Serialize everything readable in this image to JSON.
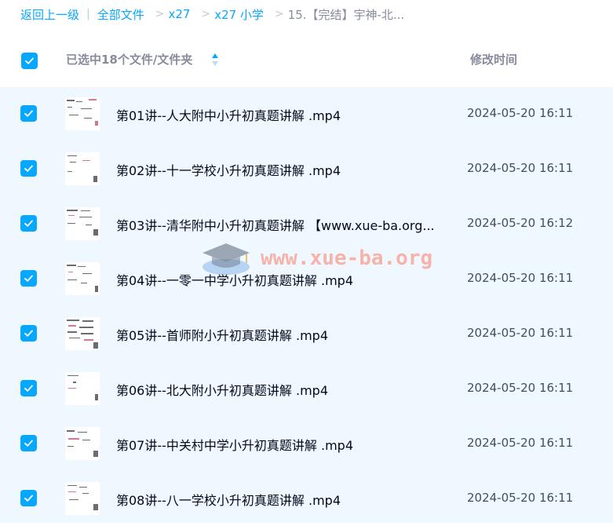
{
  "breadcrumb": {
    "back": "返回上一级",
    "sep": "|",
    "items": [
      "全部文件",
      "x27",
      "x27 小学"
    ],
    "current": "15.【完结】宇神-北..."
  },
  "header": {
    "selected_text": "已选中18个文件/文件夹",
    "time_col": "修改时间"
  },
  "files": [
    {
      "name": "第01讲--人大附中小升初真题讲解 .mp4",
      "time": "2024-05-20 16:11"
    },
    {
      "name": "第02讲--十一学校小升初真题讲解 .mp4",
      "time": "2024-05-20 16:11"
    },
    {
      "name": "第03讲--清华附中小升初真题讲解 【www.xue-ba.org...",
      "time": "2024-05-20 16:12"
    },
    {
      "name": "第04讲--一零一中学小升初真题讲解 .mp4",
      "time": "2024-05-20 16:11"
    },
    {
      "name": "第05讲--首师附小升初真题讲解 .mp4",
      "time": "2024-05-20 16:11"
    },
    {
      "name": "第06讲--北大附小升初真题讲解 .mp4",
      "time": "2024-05-20 16:11"
    },
    {
      "name": "第07讲--中关村中学小升初真题讲解 .mp4",
      "time": "2024-05-20 16:11"
    },
    {
      "name": "第08讲--八一学校小升初真题讲解 .mp4",
      "time": "2024-05-20 16:11"
    }
  ],
  "watermark": {
    "text": "www.xue-ba.org"
  },
  "colors": {
    "accent": "#06a7ff",
    "list_bg": "#eef8fe",
    "muted": "#878c9c"
  },
  "icons": {
    "checkbox": "check-icon",
    "sort": "sort-icon",
    "thumbnail": "video-thumbnail-icon"
  }
}
